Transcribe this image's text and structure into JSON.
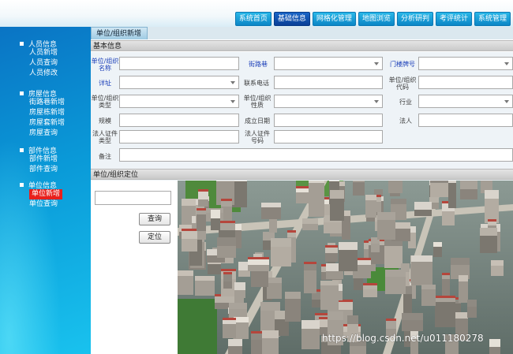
{
  "topnav": {
    "items": [
      {
        "label": "系统首页",
        "active": false
      },
      {
        "label": "基础信息",
        "active": true
      },
      {
        "label": "网格化管理",
        "active": false
      },
      {
        "label": "地图浏览",
        "active": false
      },
      {
        "label": "分析研判",
        "active": false
      },
      {
        "label": "考评统计",
        "active": false
      },
      {
        "label": "系统管理",
        "active": false
      }
    ]
  },
  "sidebar": {
    "groups": [
      {
        "label": "人员信息",
        "items": [
          "人员新增",
          "人员查询",
          "人员修改"
        ]
      },
      {
        "label": "房屋信息",
        "items": [
          "街路巷新增",
          "房屋栋新增",
          "房屋套新增",
          "房屋查询"
        ]
      },
      {
        "label": "部件信息",
        "items": [
          "部件新增",
          "部件查询"
        ]
      },
      {
        "label": "单位信息",
        "items": [
          "单位新增",
          "单位查询"
        ],
        "selected": "单位新增"
      }
    ]
  },
  "tab": {
    "label": "单位/组织新增"
  },
  "basic": {
    "title": "基本信息",
    "fields": {
      "unit_name": "单位/组织名称",
      "street": "街路巷",
      "door_no": "门楼牌号",
      "address": "详址",
      "phone": "联系电话",
      "unit_code": "单位/组织代码",
      "unit_type": "单位/组织类型",
      "unit_nature": "单位/组织性质",
      "industry": "行业",
      "scale": "规模",
      "found_date": "成立日期",
      "legal_person": "法人",
      "legal_cert_type": "法人证件类型",
      "legal_cert_no": "法人证件号码",
      "remark": "备注"
    }
  },
  "locate": {
    "title": "单位/组织定位",
    "query_btn": "查询",
    "locate_btn": "定位"
  },
  "map": {
    "watermark": "https://blog.csdn.net/u011180278"
  },
  "colors": {
    "sidebar": "#0a9ad8",
    "selected": "#e8201c",
    "nav_active": "#0a3f96"
  }
}
